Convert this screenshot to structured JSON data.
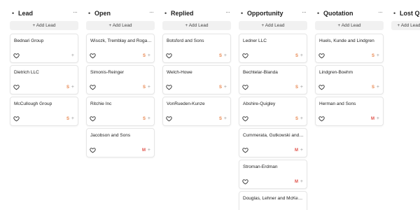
{
  "add_label": "+ Add Lead",
  "menu_glyph": "···",
  "bullet_glyph": "•",
  "heart_glyph": "heart-outline-icon",
  "plus_glyph": "+",
  "colors": {
    "avatar_orange": "#e8834a",
    "avatar_red": "#e0524a"
  },
  "columns": [
    {
      "title": "Lead",
      "cards": [
        {
          "name": "Bednari Group",
          "avatar": ""
        },
        {
          "name": "Dietrich LLC",
          "avatar": "S"
        },
        {
          "name": "McCullough Group",
          "avatar": "S"
        }
      ]
    },
    {
      "title": "Open",
      "cards": [
        {
          "name": "Wisozk, Tremblay and Rogahn",
          "avatar": "S"
        },
        {
          "name": "Simonis-Reinger",
          "avatar": "S"
        },
        {
          "name": "Ritchie Inc",
          "avatar": "S"
        },
        {
          "name": "Jacobson and Sons",
          "avatar": "M"
        }
      ]
    },
    {
      "title": "Replied",
      "cards": [
        {
          "name": "Botsford and Sons",
          "avatar": "S"
        },
        {
          "name": "Welch-Howe",
          "avatar": "S"
        },
        {
          "name": "VonRueden-Kunze",
          "avatar": "S"
        }
      ]
    },
    {
      "title": "Opportunity",
      "cards": [
        {
          "name": "Ledner LLC",
          "avatar": "S"
        },
        {
          "name": "Bechtelar-Blanda",
          "avatar": "S"
        },
        {
          "name": "Abshire-Quigley",
          "avatar": "S"
        },
        {
          "name": "Cummerata, Gutkowski and Hane",
          "avatar": "M"
        },
        {
          "name": "Stroman-Erdman",
          "avatar": "M"
        },
        {
          "name": "Douglas, Lehner and McKenzie",
          "avatar": ""
        }
      ]
    },
    {
      "title": "Quotation",
      "cards": [
        {
          "name": "Huels, Kunde and Lindgren",
          "avatar": "S"
        },
        {
          "name": "Lindgren-Boehm",
          "avatar": "S"
        },
        {
          "name": "Herman and Sons",
          "avatar": "M"
        }
      ]
    },
    {
      "title": "Lost Q",
      "cards": []
    }
  ]
}
